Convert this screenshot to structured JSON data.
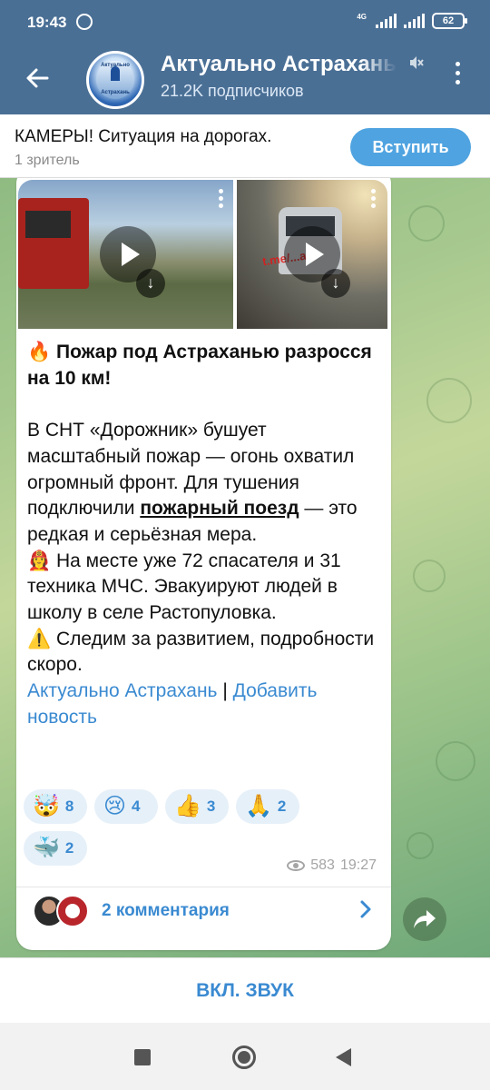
{
  "status_bar": {
    "time": "19:43",
    "network_label": "4G",
    "battery": "62"
  },
  "header": {
    "channel_title": "Актуально Астрахань",
    "subscribers": "21.2K подписчиков",
    "avatar_line1": "Актуально",
    "avatar_line2": "Астрахань",
    "back_icon": "arrow-left-icon",
    "mute_icon": "muted-speaker-icon",
    "menu_icon": "three-dots-vertical-icon"
  },
  "live_bar": {
    "title": "КАМЕРЫ! Ситуация на дорогах.",
    "viewers": "1 зритель",
    "join_label": "Вступить"
  },
  "post": {
    "media_watermark": "t.me/...a30",
    "title_emoji": "🔥",
    "title": "Пожар под Астраханью разросся на 10 км!",
    "para1_before": "В СНТ «Дорожник» бушует масштабный пожар — огонь охватил огромный фронт. Для тушения подключили ",
    "para1_link": "пожарный поезд",
    "para1_after": " — это редкая и серьёзная мера.",
    "para2_emoji": "👩‍🚒",
    "para2": " На месте уже 72 спасателя и 31 техника МЧС. Эвакуируют людей в школу в селе Растопуловка.",
    "para3_emoji": "⚠️",
    "para3": " Следим за развитием, подробности скоро.",
    "footer_link1": "Актуально Астрахань",
    "footer_sep": " | ",
    "footer_link2": "Добавить новость",
    "reactions": [
      {
        "emoji": "🤯",
        "count": "8"
      },
      {
        "emoji": "😢",
        "count": "4"
      },
      {
        "emoji": "👍",
        "count": "3"
      },
      {
        "emoji": "🙏",
        "count": "2"
      },
      {
        "emoji": "🐳",
        "count": "2"
      }
    ],
    "views": "583",
    "time": "19:27",
    "comments_label": "2 комментария"
  },
  "bottom": {
    "sound_label": "ВКЛ. ЗВУК"
  },
  "colors": {
    "header": "#4a6f95",
    "accent": "#3a8ad1",
    "join_button": "#4fa3e0"
  }
}
